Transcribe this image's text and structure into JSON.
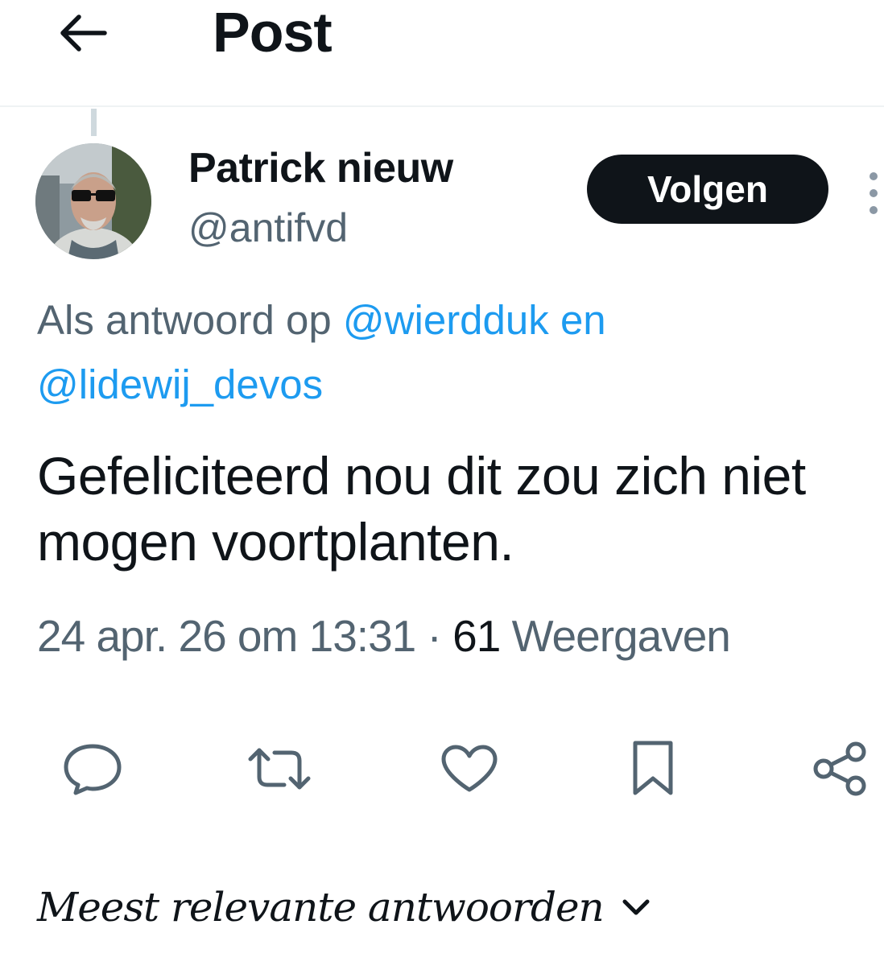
{
  "header": {
    "title": "Post",
    "back_icon": "arrow-left-icon"
  },
  "post": {
    "author": {
      "name": "Patrick nieuw",
      "handle": "@antifvd",
      "avatar_icon": "user-avatar"
    },
    "follow_label": "Volgen",
    "more_icon": "more-vertical-icon",
    "reply_to": {
      "prefix": "Als antwoord op",
      "mention_1": "@wierdduk",
      "joiner": "en",
      "mention_2": "@lidewij_devos"
    },
    "text": "Gefeliciteerd nou dit zou zich niet mogen voortplanten.",
    "timestamp": "24 apr. 26 om 13:31",
    "separator": "·",
    "views_count": "61",
    "views_label": "Weergaven"
  },
  "actions": [
    {
      "name": "reply",
      "icon": "comment-icon"
    },
    {
      "name": "repost",
      "icon": "repost-icon"
    },
    {
      "name": "like",
      "icon": "heart-icon"
    },
    {
      "name": "bookmark",
      "icon": "bookmark-icon"
    },
    {
      "name": "share",
      "icon": "share-icon"
    }
  ],
  "replies_sort": {
    "label": "Meest relevante antwoorden",
    "icon": "chevron-down-icon"
  },
  "colors": {
    "text": "#0f1419",
    "secondary": "#536471",
    "link": "#1d9bf0",
    "border": "#eff3f4",
    "button_bg": "#0f1419"
  }
}
